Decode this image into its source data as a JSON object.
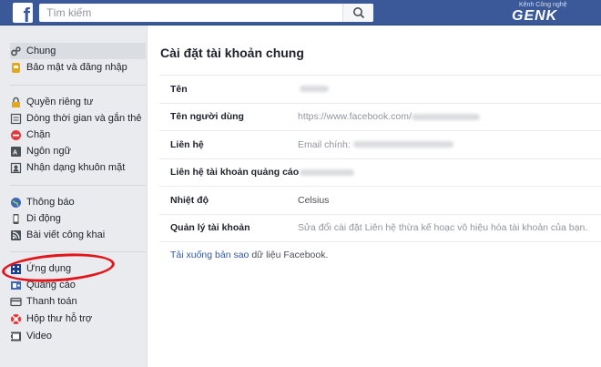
{
  "header": {
    "logo_letter": "f",
    "search_placeholder": "Tìm kiếm",
    "watermark_top": "Kênh Công nghệ",
    "watermark_main": "GENK"
  },
  "sidebar": {
    "groups": [
      [
        {
          "label": "Chung",
          "icon": "gears-icon",
          "active": true
        },
        {
          "label": "Bảo mật và đăng nhập",
          "icon": "badge-icon"
        }
      ],
      [
        {
          "label": "Quyền riêng tư",
          "icon": "lock-icon"
        },
        {
          "label": "Dòng thời gian và gắn thẻ",
          "icon": "timeline-icon"
        },
        {
          "label": "Chặn",
          "icon": "block-icon"
        },
        {
          "label": "Ngôn ngữ",
          "icon": "language-icon"
        },
        {
          "label": "Nhận dạng khuôn mặt",
          "icon": "face-icon"
        }
      ],
      [
        {
          "label": "Thông báo",
          "icon": "globe-icon"
        },
        {
          "label": "Di động",
          "icon": "mobile-icon"
        },
        {
          "label": "Bài viết công khai",
          "icon": "rss-icon"
        }
      ],
      [
        {
          "label": "Ứng dụng",
          "icon": "apps-icon"
        },
        {
          "label": "Quảng cáo",
          "icon": "ads-icon"
        },
        {
          "label": "Thanh toán",
          "icon": "payment-icon"
        },
        {
          "label": "Hộp thư hỗ trợ",
          "icon": "lifebuoy-icon"
        },
        {
          "label": "Video",
          "icon": "video-icon"
        }
      ]
    ]
  },
  "main": {
    "title": "Cài đặt tài khoản chung",
    "rows": [
      {
        "label": "Tên",
        "value": ""
      },
      {
        "label": "Tên người dùng",
        "value": "https://www.facebook.com/"
      },
      {
        "label": "Liên hệ",
        "value": "Email chính: "
      },
      {
        "label": "Liên hệ tài khoản quảng cáo",
        "value": ""
      },
      {
        "label": "Nhiệt độ",
        "value": "Celsius"
      },
      {
        "label": "Quản lý tài khoản",
        "value": "Sửa đổi cài đặt Liên hệ thừa kế hoạc vô hiệu hóa tài khoản của bạn."
      }
    ],
    "download_link": "Tải xuống bản sao",
    "download_text": " dữ liệu Facebook."
  },
  "colors": {
    "brand": "#3b5998",
    "annotation": "#e4141b"
  }
}
